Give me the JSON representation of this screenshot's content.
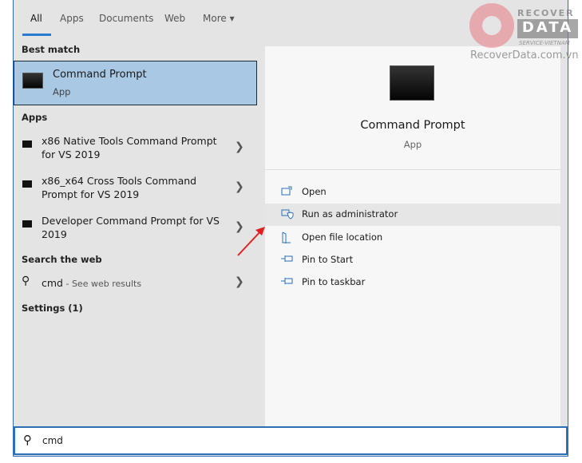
{
  "tabs": [
    {
      "label": "All",
      "active": true
    },
    {
      "label": "Apps"
    },
    {
      "label": "Documents"
    },
    {
      "label": "Web"
    },
    {
      "label": "More ▾"
    }
  ],
  "left": {
    "best_match_header": "Best match",
    "best_match": {
      "title": "Command Prompt",
      "subtitle": "App"
    },
    "apps_header": "Apps",
    "apps": [
      {
        "label": "x86 Native Tools Command Prompt for VS 2019"
      },
      {
        "label": "x86_x64 Cross Tools Command Prompt for VS 2019"
      },
      {
        "label": "Developer Command Prompt for VS 2019"
      }
    ],
    "web_header": "Search the web",
    "web": {
      "query": "cmd",
      "suffix": " - See web results"
    },
    "settings_header": "Settings (1)"
  },
  "right": {
    "title": "Command Prompt",
    "subtitle": "App",
    "actions": [
      {
        "label": "Open",
        "icon": "open-icon"
      },
      {
        "label": "Run as administrator",
        "icon": "shield-icon",
        "highlighted": true
      },
      {
        "label": "Open file location",
        "icon": "folder-icon"
      },
      {
        "label": "Pin to Start",
        "icon": "pin-icon"
      },
      {
        "label": "Pin to taskbar",
        "icon": "pin-icon"
      }
    ]
  },
  "search": {
    "value": "cmd"
  },
  "watermark": {
    "line1": "RECOVER",
    "line2": "DATA",
    "line3": "SERVICE-VIETNAM",
    "url": "RecoverData.com.vn"
  },
  "colors": {
    "accent": "#2a7bd4",
    "selection": "#a8c8e4",
    "arrow": "#e02020"
  }
}
